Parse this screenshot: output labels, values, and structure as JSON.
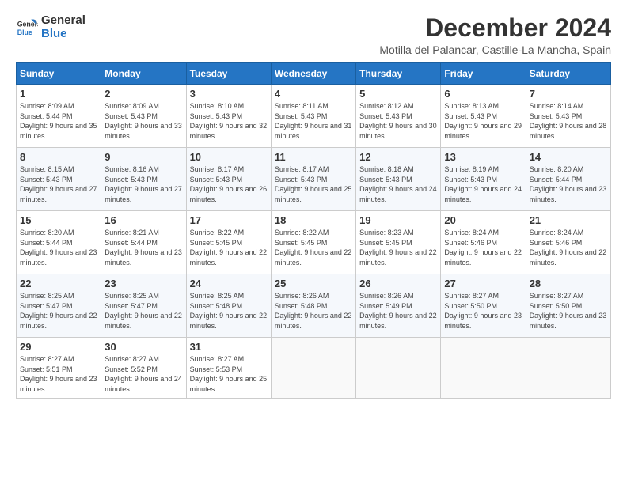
{
  "logo": {
    "line1": "General",
    "line2": "Blue"
  },
  "title": "December 2024",
  "location": "Motilla del Palancar, Castille-La Mancha, Spain",
  "days_of_week": [
    "Sunday",
    "Monday",
    "Tuesday",
    "Wednesday",
    "Thursday",
    "Friday",
    "Saturday"
  ],
  "weeks": [
    [
      {
        "day": "1",
        "sunrise": "8:09 AM",
        "sunset": "5:44 PM",
        "daylight": "9 hours and 35 minutes."
      },
      {
        "day": "2",
        "sunrise": "8:09 AM",
        "sunset": "5:43 PM",
        "daylight": "9 hours and 33 minutes."
      },
      {
        "day": "3",
        "sunrise": "8:10 AM",
        "sunset": "5:43 PM",
        "daylight": "9 hours and 32 minutes."
      },
      {
        "day": "4",
        "sunrise": "8:11 AM",
        "sunset": "5:43 PM",
        "daylight": "9 hours and 31 minutes."
      },
      {
        "day": "5",
        "sunrise": "8:12 AM",
        "sunset": "5:43 PM",
        "daylight": "9 hours and 30 minutes."
      },
      {
        "day": "6",
        "sunrise": "8:13 AM",
        "sunset": "5:43 PM",
        "daylight": "9 hours and 29 minutes."
      },
      {
        "day": "7",
        "sunrise": "8:14 AM",
        "sunset": "5:43 PM",
        "daylight": "9 hours and 28 minutes."
      }
    ],
    [
      {
        "day": "8",
        "sunrise": "8:15 AM",
        "sunset": "5:43 PM",
        "daylight": "9 hours and 27 minutes."
      },
      {
        "day": "9",
        "sunrise": "8:16 AM",
        "sunset": "5:43 PM",
        "daylight": "9 hours and 27 minutes."
      },
      {
        "day": "10",
        "sunrise": "8:17 AM",
        "sunset": "5:43 PM",
        "daylight": "9 hours and 26 minutes."
      },
      {
        "day": "11",
        "sunrise": "8:17 AM",
        "sunset": "5:43 PM",
        "daylight": "9 hours and 25 minutes."
      },
      {
        "day": "12",
        "sunrise": "8:18 AM",
        "sunset": "5:43 PM",
        "daylight": "9 hours and 24 minutes."
      },
      {
        "day": "13",
        "sunrise": "8:19 AM",
        "sunset": "5:43 PM",
        "daylight": "9 hours and 24 minutes."
      },
      {
        "day": "14",
        "sunrise": "8:20 AM",
        "sunset": "5:44 PM",
        "daylight": "9 hours and 23 minutes."
      }
    ],
    [
      {
        "day": "15",
        "sunrise": "8:20 AM",
        "sunset": "5:44 PM",
        "daylight": "9 hours and 23 minutes."
      },
      {
        "day": "16",
        "sunrise": "8:21 AM",
        "sunset": "5:44 PM",
        "daylight": "9 hours and 23 minutes."
      },
      {
        "day": "17",
        "sunrise": "8:22 AM",
        "sunset": "5:45 PM",
        "daylight": "9 hours and 22 minutes."
      },
      {
        "day": "18",
        "sunrise": "8:22 AM",
        "sunset": "5:45 PM",
        "daylight": "9 hours and 22 minutes."
      },
      {
        "day": "19",
        "sunrise": "8:23 AM",
        "sunset": "5:45 PM",
        "daylight": "9 hours and 22 minutes."
      },
      {
        "day": "20",
        "sunrise": "8:24 AM",
        "sunset": "5:46 PM",
        "daylight": "9 hours and 22 minutes."
      },
      {
        "day": "21",
        "sunrise": "8:24 AM",
        "sunset": "5:46 PM",
        "daylight": "9 hours and 22 minutes."
      }
    ],
    [
      {
        "day": "22",
        "sunrise": "8:25 AM",
        "sunset": "5:47 PM",
        "daylight": "9 hours and 22 minutes."
      },
      {
        "day": "23",
        "sunrise": "8:25 AM",
        "sunset": "5:47 PM",
        "daylight": "9 hours and 22 minutes."
      },
      {
        "day": "24",
        "sunrise": "8:25 AM",
        "sunset": "5:48 PM",
        "daylight": "9 hours and 22 minutes."
      },
      {
        "day": "25",
        "sunrise": "8:26 AM",
        "sunset": "5:48 PM",
        "daylight": "9 hours and 22 minutes."
      },
      {
        "day": "26",
        "sunrise": "8:26 AM",
        "sunset": "5:49 PM",
        "daylight": "9 hours and 22 minutes."
      },
      {
        "day": "27",
        "sunrise": "8:27 AM",
        "sunset": "5:50 PM",
        "daylight": "9 hours and 23 minutes."
      },
      {
        "day": "28",
        "sunrise": "8:27 AM",
        "sunset": "5:50 PM",
        "daylight": "9 hours and 23 minutes."
      }
    ],
    [
      {
        "day": "29",
        "sunrise": "8:27 AM",
        "sunset": "5:51 PM",
        "daylight": "9 hours and 23 minutes."
      },
      {
        "day": "30",
        "sunrise": "8:27 AM",
        "sunset": "5:52 PM",
        "daylight": "9 hours and 24 minutes."
      },
      {
        "day": "31",
        "sunrise": "8:27 AM",
        "sunset": "5:53 PM",
        "daylight": "9 hours and 25 minutes."
      },
      null,
      null,
      null,
      null
    ]
  ]
}
